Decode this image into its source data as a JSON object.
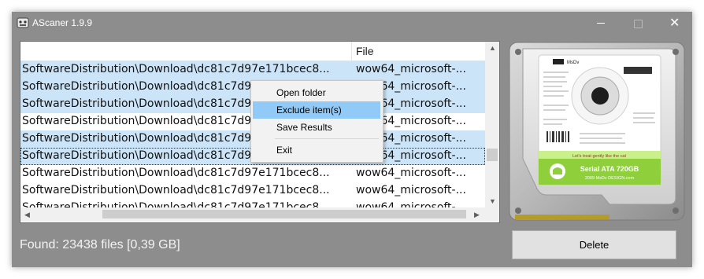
{
  "window": {
    "title": "AScaner 1.9.9",
    "controls": {
      "minimize": "minimize",
      "maximize": "maximize",
      "close": "✕"
    }
  },
  "list": {
    "columns": [
      "",
      "File"
    ],
    "rows": [
      {
        "path": "SoftwareDistribution\\Download\\dc81c7d97e171bcec8...",
        "file": "wow64_microsoft-...",
        "selected": true
      },
      {
        "path": "SoftwareDistribution\\Download\\dc81c7d97e171bcec8...",
        "file": "wow64_microsoft-...",
        "selected": true
      },
      {
        "path": "SoftwareDistribution\\Download\\dc81c7d97e171bcec8...",
        "file": "wow64_microsoft-...",
        "selected": true
      },
      {
        "path": "SoftwareDistribution\\Download\\dc81c7d97e171bcec8...",
        "file": "wow64_microsoft-...",
        "selected": false
      },
      {
        "path": "SoftwareDistribution\\Download\\dc81c7d97e171bcec8...",
        "file": "wow64_microsoft-...",
        "selected": true
      },
      {
        "path": "SoftwareDistribution\\Download\\dc81c7d97e171bcec8...",
        "file": "wow64_microsoft-...",
        "selected": true
      },
      {
        "path": "SoftwareDistribution\\Download\\dc81c7d97e171bcec8...",
        "file": "wow64_microsoft-...",
        "selected": false
      },
      {
        "path": "SoftwareDistribution\\Download\\dc81c7d97e171bcec8...",
        "file": "wow64_microsoft-...",
        "selected": false
      },
      {
        "path": "SoftwareDistribution\\Download\\dc81c7d97e171bcec8...",
        "file": "wow64_microsoft-...",
        "selected": false
      }
    ]
  },
  "context_menu": {
    "items": [
      "Open folder",
      "Exclude item(s)",
      "Save Results",
      "Exit"
    ],
    "highlighted": "Exclude item(s)"
  },
  "status": {
    "found_text": "Found: 23438 files [0,39 GB]"
  },
  "actions": {
    "delete_label": "Delete"
  },
  "hdd_image": {
    "label_model": "Serial ATA 720GB",
    "label_brand": "MsDv",
    "label_footer": "2009 MsDv DESIGN.com",
    "warning": "Let's treat gently like the cat"
  },
  "colors": {
    "window_bg": "#8d8d8d",
    "selection": "#cce4f7",
    "menu_highlight": "#91c9f7",
    "hdd_label_green": "#8fcf3c"
  }
}
